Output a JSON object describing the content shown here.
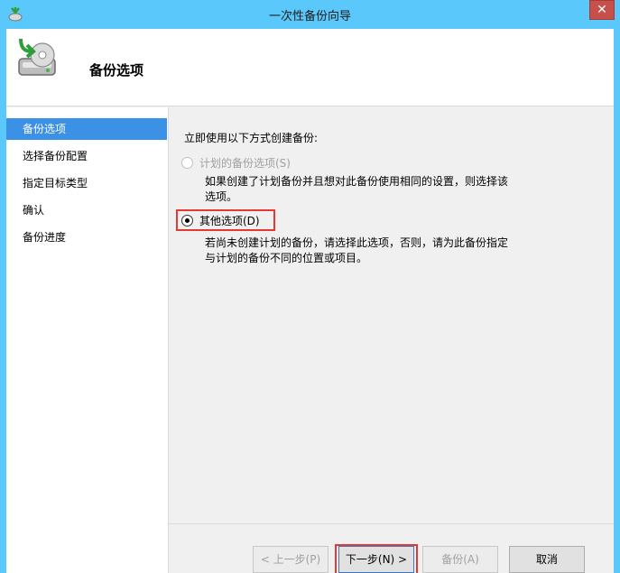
{
  "window": {
    "title": "一次性备份向导",
    "close_glyph": "✕"
  },
  "header": {
    "title": "备份选项"
  },
  "nav": {
    "items": [
      {
        "label": "备份选项",
        "selected": true
      },
      {
        "label": "选择备份配置",
        "selected": false
      },
      {
        "label": "指定目标类型",
        "selected": false
      },
      {
        "label": "确认",
        "selected": false
      },
      {
        "label": "备份进度",
        "selected": false
      }
    ]
  },
  "main": {
    "prompt": "立即使用以下方式创建备份:",
    "options": [
      {
        "label": "计划的备份选项(S)",
        "enabled": false,
        "checked": false,
        "description": "如果创建了计划备份并且想对此备份使用相同的设置，则选择该选项。"
      },
      {
        "label": "其他选项(D)",
        "enabled": true,
        "checked": true,
        "description": "若尚未创建计划的备份，请选择此选项，否则，请为此备份指定与计划的备份不同的位置或项目。"
      }
    ]
  },
  "buttons": {
    "prev": {
      "label": "< 上一步(P)",
      "enabled": false
    },
    "next": {
      "label": "下一步(N) >",
      "enabled": true
    },
    "backup": {
      "label": "备份(A)",
      "enabled": false
    },
    "cancel": {
      "label": "取消",
      "enabled": true
    }
  },
  "colors": {
    "titlebar": "#5ac8fa",
    "nav_selected": "#3b91e6",
    "highlight": "#e53935",
    "close": "#c7504a"
  }
}
